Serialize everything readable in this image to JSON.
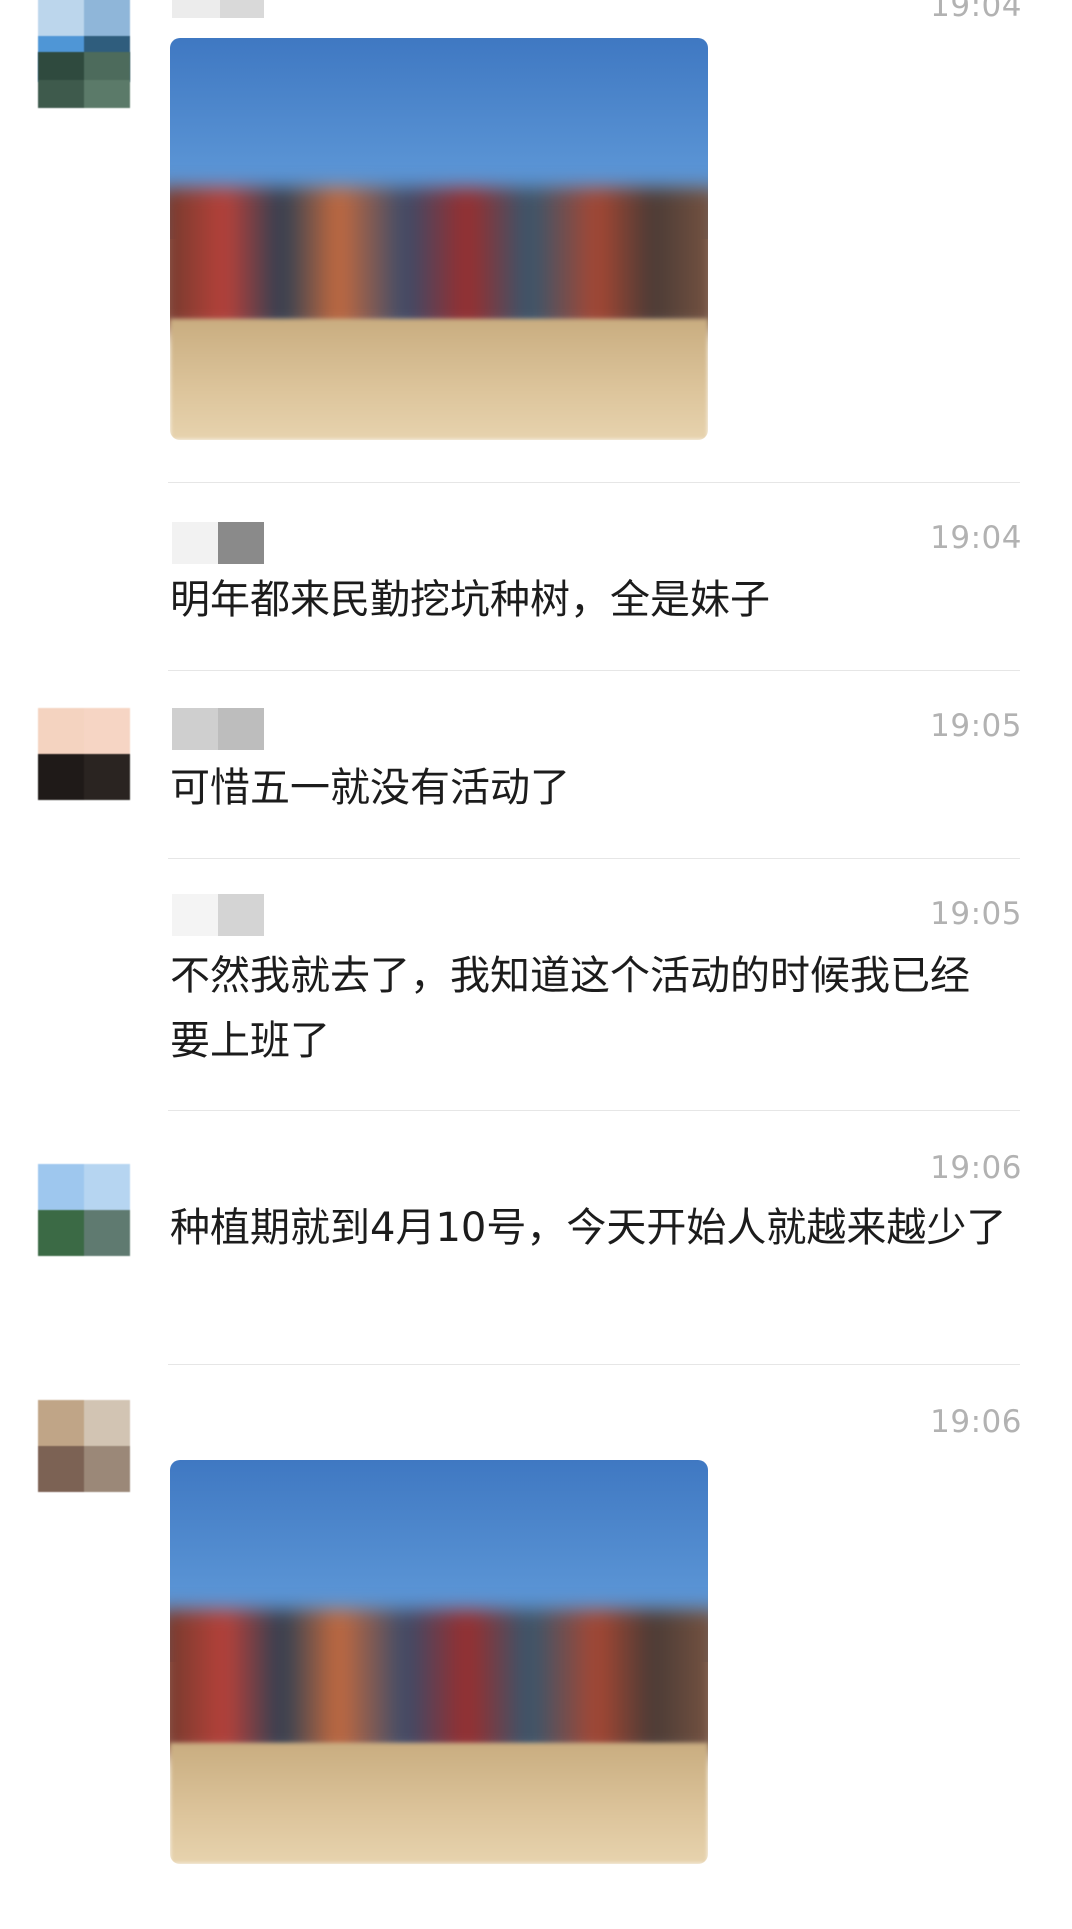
{
  "messages": [
    {
      "type": "image",
      "time": "19:04"
    },
    {
      "type": "text",
      "time": "19:04",
      "text": "明年都来民勤挖坑种树，全是妹子"
    },
    {
      "type": "text",
      "time": "19:05",
      "text": "可惜五一就没有活动了"
    },
    {
      "type": "text",
      "time": "19:05",
      "text": "不然我就去了，我知道这个活动的时候我已经要上班了"
    },
    {
      "type": "text",
      "time": "19:06",
      "text": "种植期就到4月10号，今天开始人就越来越少了"
    },
    {
      "type": "image",
      "time": "19:06"
    }
  ],
  "colors": {
    "background": "#ffffff",
    "time_text": "#b2b2b2",
    "message_text": "#1c1c1c",
    "divider": "#e6e6e6"
  }
}
